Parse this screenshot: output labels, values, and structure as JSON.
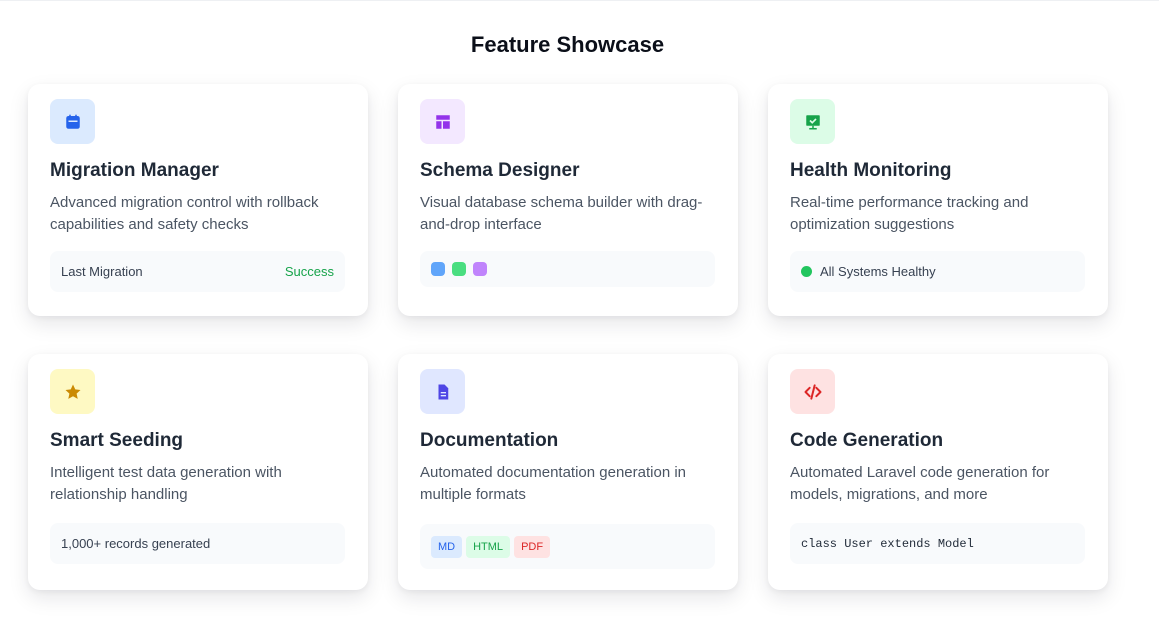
{
  "page": {
    "title": "Feature Showcase"
  },
  "cards": [
    {
      "icon": "calendar-icon",
      "icon_bg": "#dbeafe",
      "icon_color": "#2563eb",
      "title": "Migration Manager",
      "desc": "Advanced migration control with rollback capabilities and safety checks",
      "footer_label": "Last Migration",
      "footer_status": "Success",
      "status_color": "#16a34a"
    },
    {
      "icon": "layout-icon",
      "icon_bg": "#f3e8ff",
      "icon_color": "#9333ea",
      "title": "Schema Designer",
      "desc": "Visual database schema builder with drag-and-drop interface",
      "dot_colors": [
        "#60a5fa",
        "#4ade80",
        "#c084fc"
      ]
    },
    {
      "icon": "presentation-check-icon",
      "icon_bg": "#dcfce7",
      "icon_color": "#16a34a",
      "title": "Health Monitoring",
      "desc": "Real-time performance tracking and optimization suggestions",
      "footer_label": "All Systems Healthy",
      "status_color": "#22c55e"
    },
    {
      "icon": "star-icon",
      "icon_bg": "#fef9c3",
      "icon_color": "#ca8a04",
      "title": "Smart Seeding",
      "desc": "Intelligent test data generation with relationship handling",
      "footer_label": "1,000+ records generated"
    },
    {
      "icon": "document-icon",
      "icon_bg": "#e0e7ff",
      "icon_color": "#4f46e5",
      "title": "Documentation",
      "desc": "Automated documentation generation in multiple formats",
      "tags": [
        {
          "label": "MD",
          "bg": "#dbeafe",
          "color": "#2563eb"
        },
        {
          "label": "HTML",
          "bg": "#dcfce7",
          "color": "#16a34a"
        },
        {
          "label": "PDF",
          "bg": "#fee2e2",
          "color": "#dc2626"
        }
      ]
    },
    {
      "icon": "code-icon",
      "icon_bg": "#fee2e2",
      "icon_color": "#dc2626",
      "title": "Code Generation",
      "desc": "Automated Laravel code generation for models, migrations, and more",
      "footer_code": "class User extends Model"
    }
  ]
}
